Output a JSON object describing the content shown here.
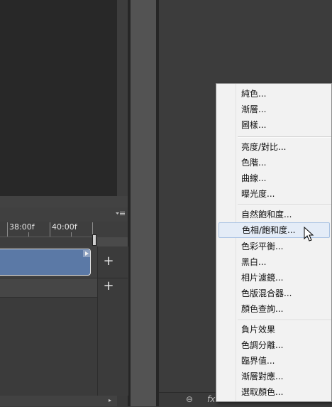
{
  "timeline": {
    "ruler_labels": [
      "38:00f",
      "40:00f"
    ]
  },
  "icons": {
    "add_track": "+",
    "link": "link-icon",
    "fx": "fx",
    "panel_menu": "panel-menu-icon",
    "scroll_right": "▸"
  },
  "bottom_bar": {
    "link_glyph": "⊖",
    "fx_label": "fx"
  },
  "menu": {
    "group1": [
      "純色...",
      "漸層...",
      "圖樣..."
    ],
    "group2": [
      "亮度/對比...",
      "色階...",
      "曲線...",
      "曝光度..."
    ],
    "group3": [
      "自然飽和度...",
      "色相/飽和度...",
      "色彩平衡...",
      "黑白...",
      "相片濾鏡...",
      "色版混合器...",
      "顏色查詢..."
    ],
    "group4": [
      "負片效果",
      "色調分離...",
      "臨界值...",
      "漸層對應...",
      "選取顏色..."
    ],
    "highlighted": "色相/飽和度..."
  },
  "colors": {
    "clip": "#5b79a6",
    "menu_bg": "#f2f2f2",
    "highlight": "#e4ecf7"
  }
}
